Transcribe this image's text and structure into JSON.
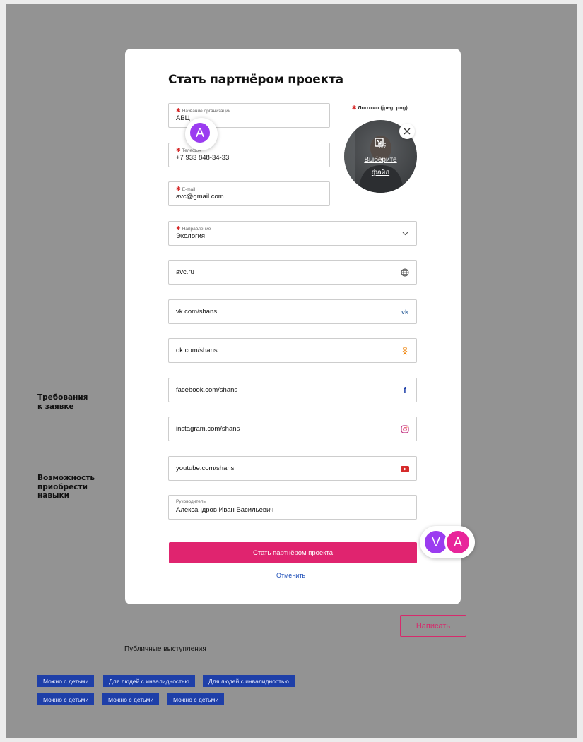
{
  "modal": {
    "title": "Стать партнёром проекта",
    "logo_label": "Логотип (jpeg, png)",
    "logo_choose": "Выберите\nфайл",
    "fields": {
      "org": {
        "label": "Название организации",
        "value": "АВЦ"
      },
      "phone": {
        "label": "Телефон",
        "value": "+7 933 848-34-33"
      },
      "email": {
        "label": "E-mail",
        "value": "avc@gmail.com"
      },
      "direction": {
        "label": "Направление",
        "value": "Экология"
      },
      "site": {
        "value": "avc.ru",
        "icon": "globe-icon"
      },
      "vk": {
        "value": "vk.com/shans",
        "icon": "vk-icon",
        "color": "#4a76a8"
      },
      "ok": {
        "value": "ok.com/shans",
        "icon": "odnoklassniki-icon",
        "color": "#ee8208"
      },
      "facebook": {
        "value": "facebook.com/shans",
        "icon": "facebook-icon",
        "color": "#1e3fa8"
      },
      "instagram": {
        "value": "instagram.com/shans",
        "icon": "instagram-icon",
        "color": "#c13584"
      },
      "youtube": {
        "value": "youtube.com/shans",
        "icon": "youtube-icon",
        "color": "#d62a2a"
      },
      "head": {
        "label": "Руководитель",
        "value": "Александров Иван Васильевич"
      }
    },
    "submit_label": "Стать партнёром проекта",
    "cancel_label": "Отменить"
  },
  "background": {
    "requirements_label": "Требования\nк заявке",
    "skills_label": "Возможность\nприобрести\nнавыки",
    "write_button": "Написать",
    "public_talks": "Публичные выступления",
    "tags_row1": [
      "Можно с детьми",
      "Для людей с инвалидностью",
      "Для людей с инвалидностью"
    ],
    "tags_row2": [
      "Можно с детьми",
      "Можно с детьми",
      "Можно с детьми"
    ]
  },
  "collaborators": {
    "cursor_avatar": "A",
    "pair": [
      "V",
      "A"
    ]
  },
  "colors": {
    "accent": "#e0246f",
    "link": "#1e4fb8",
    "tag_bg": "#1e3fa8",
    "avatar_purple": "#9b3cf0",
    "avatar_pink": "#e8259a"
  }
}
